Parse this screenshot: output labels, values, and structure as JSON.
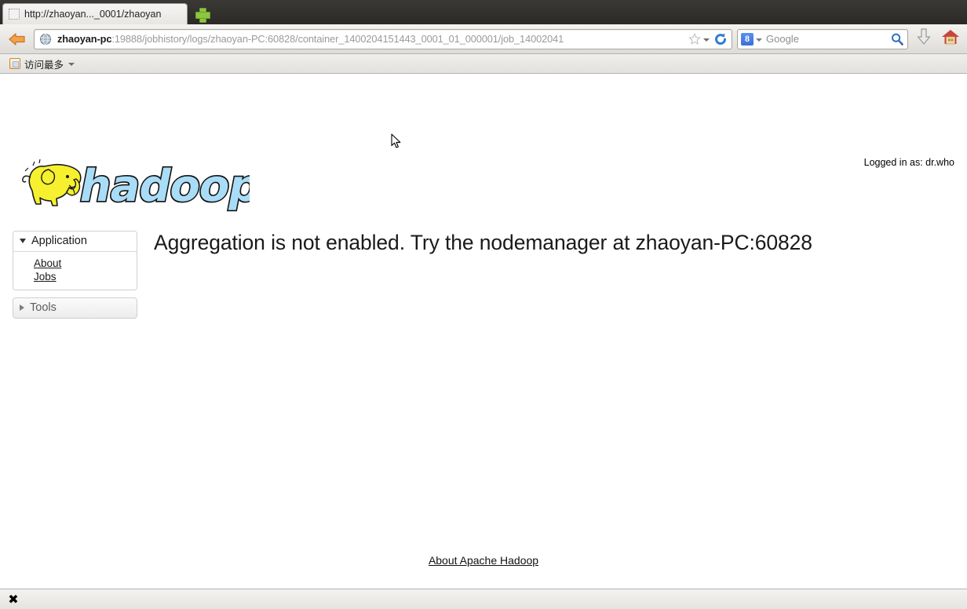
{
  "browser": {
    "tab": {
      "title": "http://zhaoyan..._0001/zhaoyan",
      "favicon_name": "blank-page-icon"
    },
    "new_tab_label": "+",
    "back_button_label": "Back",
    "url": {
      "host": "zhaoyan-pc",
      "path": ":19888/jobhistory/logs/zhaoyan-PC:60828/container_1400204151443_0001_01_000001/job_14002041",
      "full": "zhaoyan-pc:19888/jobhistory/logs/zhaoyan-PC:60828/container_1400204151443_0001_01_000001/job_14002041"
    },
    "search": {
      "engine": "Google",
      "engine_initial": "8",
      "placeholder": "Google"
    },
    "bookmarks": [
      {
        "label": "访问最多"
      }
    ],
    "toolbar_icons": [
      "download-icon",
      "home-icon"
    ]
  },
  "page": {
    "logged_in_text": "Logged in as: dr.who",
    "logo_alt": "hadoop",
    "sidebar": {
      "application": {
        "label": "Application",
        "expanded": true,
        "items": [
          {
            "label": "About"
          },
          {
            "label": "Jobs"
          }
        ]
      },
      "tools": {
        "label": "Tools",
        "expanded": false
      }
    },
    "main_message": "Aggregation is not enabled. Try the nodemanager at zhaoyan-PC:60828",
    "footer_link": "About Apache Hadoop"
  },
  "statusbar": {
    "close_label": "✖"
  },
  "colors": {
    "hadoop_blue": "#a6dcf5",
    "hadoop_yellow": "#f7f14a",
    "accent_green": "#8cc63e",
    "chrome_dark": "#33312e"
  }
}
